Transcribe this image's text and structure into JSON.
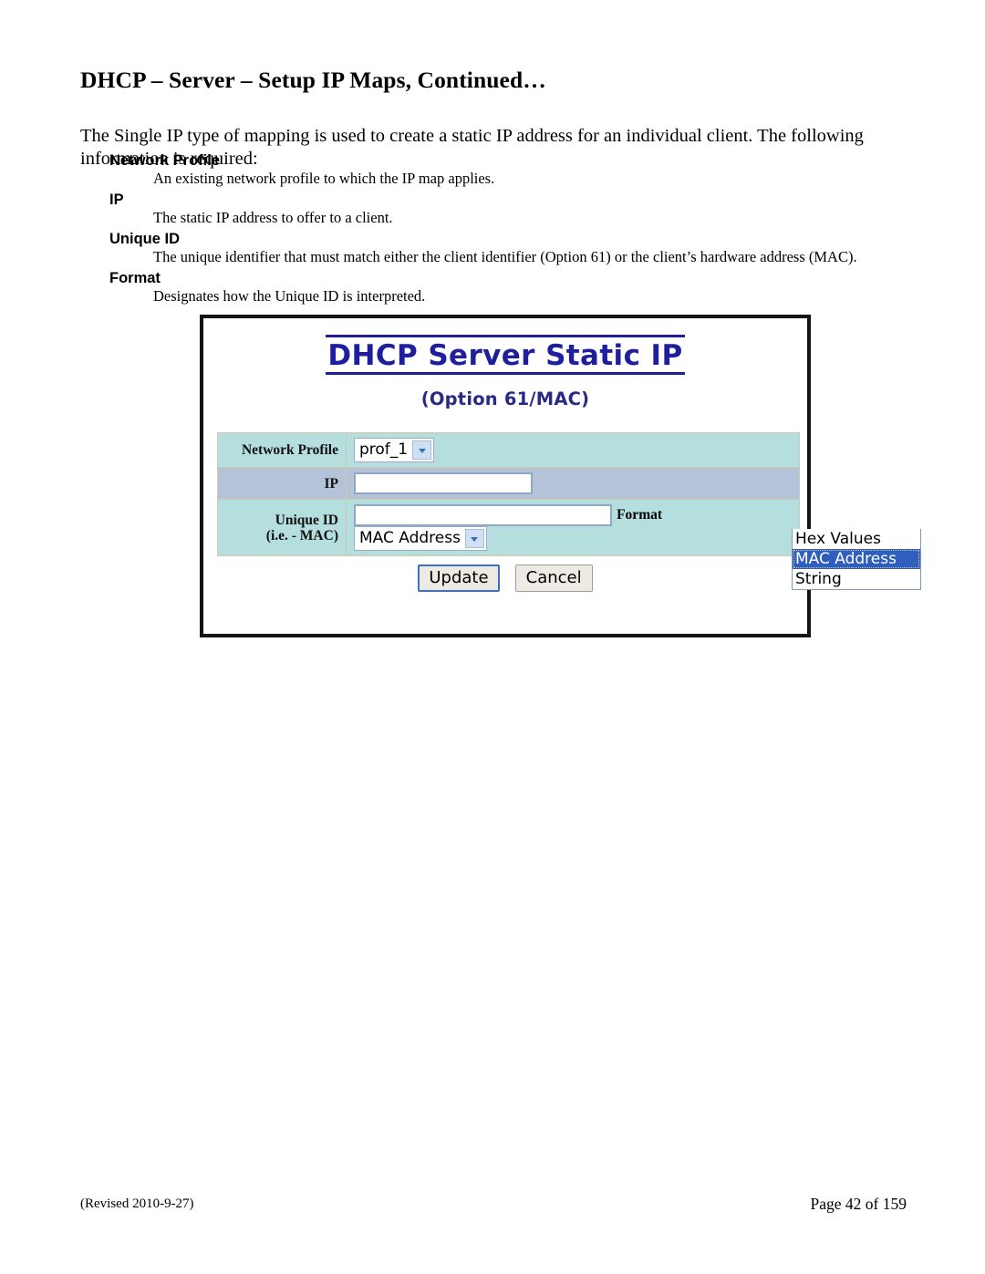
{
  "document": {
    "title": "DHCP – Server – Setup IP Maps, Continued…",
    "intro": "The Single IP type of mapping is used to create a static IP address for an individual client.  The following information is required:",
    "definitions": [
      {
        "term": "Network Profile",
        "description": "An existing network profile to which the IP map applies."
      },
      {
        "term": "IP",
        "description": "The static IP address to offer to a client."
      },
      {
        "term": "Unique ID",
        "description": "The unique identifier that must match either the client identifier (Option 61) or the client’s hardware address (MAC)."
      },
      {
        "term": "Format",
        "description": "Designates how the Unique ID is interpreted."
      }
    ],
    "footer": {
      "revision": "(Revised 2010-9-27)",
      "page": "Page 42 of 159"
    }
  },
  "screenshot": {
    "heading": "DHCP Server Static IP",
    "subheading": "(Option 61/MAC)",
    "heading_color": "#1f1f9e",
    "row_color_a": "#b5dede",
    "row_color_b": "#b5c3d8",
    "form": {
      "rows": [
        {
          "label": "Network Profile",
          "control": "select",
          "value": "prof_1"
        },
        {
          "label": "IP",
          "control": "text",
          "value": ""
        },
        {
          "label_line1": "Unique ID",
          "label_line2": "(i.e. - MAC)",
          "control": "text",
          "value": ""
        }
      ],
      "format_label": "Format",
      "format_value": "MAC Address",
      "format_options": [
        "Hex Values",
        "MAC Address",
        "String"
      ],
      "format_selected_index": 1,
      "highlight_color": "#2f5fbe"
    },
    "buttons": {
      "update": "Update",
      "cancel": "Cancel"
    }
  }
}
